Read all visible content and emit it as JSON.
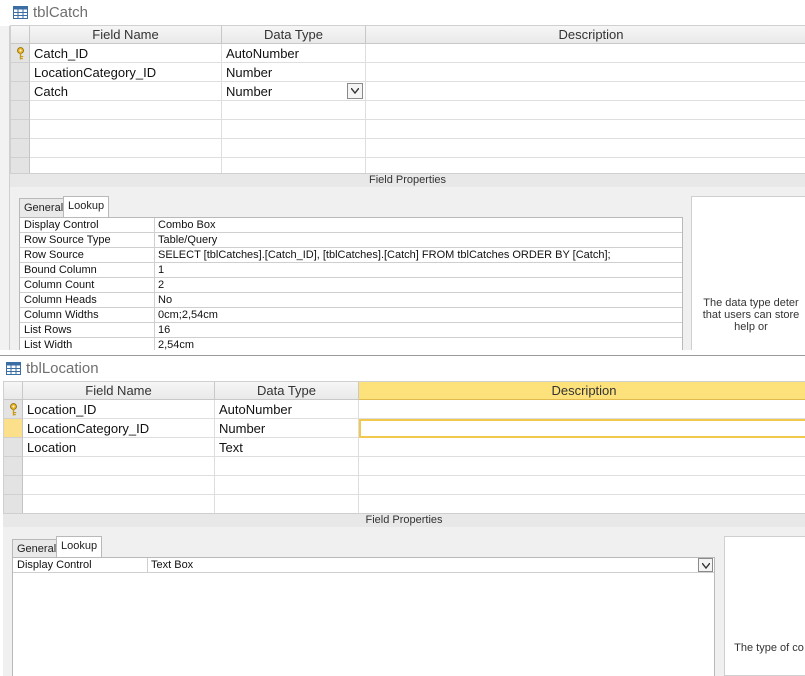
{
  "catch_table": {
    "title": "tblCatch",
    "headers": {
      "field_name": "Field Name",
      "data_type": "Data Type",
      "description": "Description"
    },
    "rows": [
      {
        "field": "Catch_ID",
        "type": "AutoNumber",
        "key": true
      },
      {
        "field": "LocationCategory_ID",
        "type": "Number",
        "key": false
      },
      {
        "field": "Catch",
        "type": "Number",
        "key": false,
        "dropdown": true
      }
    ],
    "field_properties_label": "Field Properties",
    "tabs": {
      "general": "General",
      "lookup": "Lookup"
    },
    "properties": [
      {
        "label": "Display Control",
        "value": "Combo Box"
      },
      {
        "label": "Row Source Type",
        "value": "Table/Query"
      },
      {
        "label": "Row Source",
        "value": "SELECT [tblCatches].[Catch_ID], [tblCatches].[Catch] FROM tblCatches ORDER BY [Catch];"
      },
      {
        "label": "Bound Column",
        "value": "1"
      },
      {
        "label": "Column Count",
        "value": "2"
      },
      {
        "label": "Column Heads",
        "value": "No"
      },
      {
        "label": "Column Widths",
        "value": "0cm;2,54cm"
      },
      {
        "label": "List Rows",
        "value": "16"
      },
      {
        "label": "List Width",
        "value": "2,54cm"
      }
    ],
    "help_lines": [
      "The data type deter",
      "that users can store",
      "help or"
    ]
  },
  "location_table": {
    "title": "tblLocation",
    "headers": {
      "field_name": "Field Name",
      "data_type": "Data Type",
      "description": "Description"
    },
    "rows": [
      {
        "field": "Location_ID",
        "type": "AutoNumber",
        "key": true
      },
      {
        "field": "LocationCategory_ID",
        "type": "Number",
        "key": false
      },
      {
        "field": "Location",
        "type": "Text",
        "key": false
      }
    ],
    "field_properties_label": "Field Properties",
    "tabs": {
      "general": "General",
      "lookup": "Lookup"
    },
    "properties": [
      {
        "label": "Display Control",
        "value": "Text Box"
      }
    ],
    "help_text": "The type of co"
  },
  "colors": {
    "highlight": "#fcdf8a",
    "description_header_active": "#fde27c",
    "key_icon": "#d4a017"
  }
}
